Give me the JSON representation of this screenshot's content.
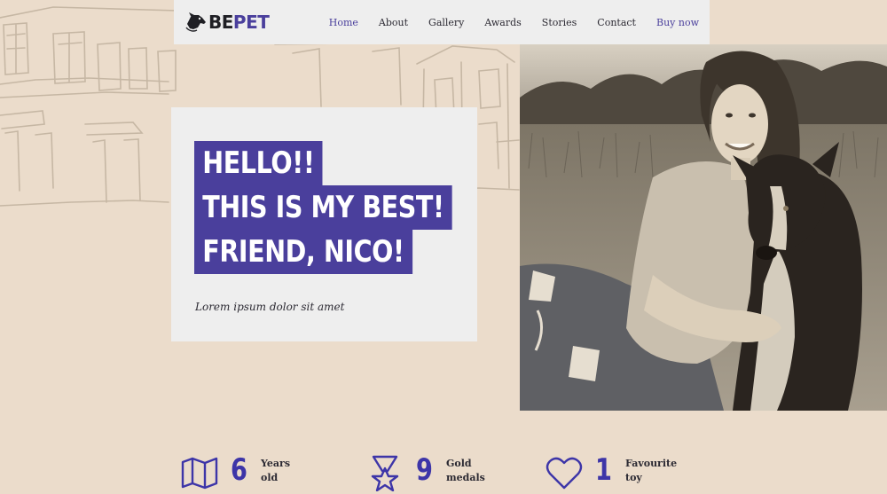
{
  "brand": {
    "part1": "BE",
    "part2": "PET"
  },
  "nav": {
    "items": [
      {
        "label": "Home",
        "active": true
      },
      {
        "label": "About"
      },
      {
        "label": "Gallery"
      },
      {
        "label": "Awards"
      },
      {
        "label": "Stories"
      },
      {
        "label": "Contact"
      },
      {
        "label": "Buy now",
        "highlight": true
      }
    ]
  },
  "hero": {
    "lines": [
      "HELLO!!",
      "THIS IS MY BEST!",
      "FRIEND, NICO!"
    ],
    "subtitle": "Lorem ipsum dolor sit amet",
    "photo_icon": "woman-with-dog-photo"
  },
  "stats": [
    {
      "icon": "map-icon",
      "number": "6",
      "label_line1": "Years",
      "label_line2": "old"
    },
    {
      "icon": "medal-icon",
      "number": "9",
      "label_line1": "Gold",
      "label_line2": "medals"
    },
    {
      "icon": "heart-icon",
      "number": "1",
      "label_line1": "Favourite",
      "label_line2": "toy"
    }
  ],
  "colors": {
    "accent": "#4a3f9c",
    "number": "#3d35a8",
    "background": "#ebdccb",
    "card": "#eeeeee"
  }
}
